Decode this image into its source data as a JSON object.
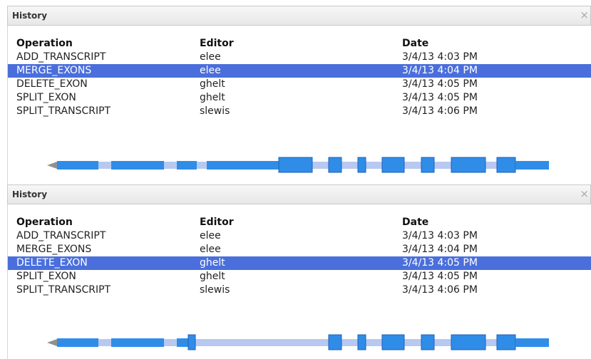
{
  "colors": {
    "selection": "#4a6fdc",
    "exon_fill": "#2f8de8",
    "intron": "#b7c9f0",
    "exon_outline": "#1f5fb8"
  },
  "panels": [
    {
      "title": "History",
      "close_glyph": "×",
      "columns": [
        "Operation",
        "Editor",
        "Date"
      ],
      "rows": [
        {
          "operation": "ADD_TRANSCRIPT",
          "editor": "elee",
          "date": "3/4/13 4:03 PM"
        },
        {
          "operation": "MERGE_EXONS",
          "editor": "elee",
          "date": "3/4/13 4:04 PM"
        },
        {
          "operation": "DELETE_EXON",
          "editor": "ghelt",
          "date": "3/4/13 4:05 PM"
        },
        {
          "operation": "SPLIT_EXON",
          "editor": "ghelt",
          "date": "3/4/13 4:05 PM"
        },
        {
          "operation": "SPLIT_TRANSCRIPT",
          "editor": "slewis",
          "date": "3/4/13 4:06 PM"
        }
      ],
      "selected_row_index": 1
    },
    {
      "title": "History",
      "close_glyph": "×",
      "columns": [
        "Operation",
        "Editor",
        "Date"
      ],
      "rows": [
        {
          "operation": "ADD_TRANSCRIPT",
          "editor": "elee",
          "date": "3/4/13 4:03 PM"
        },
        {
          "operation": "MERGE_EXONS",
          "editor": "elee",
          "date": "3/4/13 4:04 PM"
        },
        {
          "operation": "DELETE_EXON",
          "editor": "ghelt",
          "date": "3/4/13 4:05 PM"
        },
        {
          "operation": "SPLIT_EXON",
          "editor": "ghelt",
          "date": "3/4/13 4:05 PM"
        },
        {
          "operation": "SPLIT_TRANSCRIPT",
          "editor": "slewis",
          "date": "3/4/13 4:06 PM"
        }
      ],
      "selected_row_index": 2
    }
  ]
}
